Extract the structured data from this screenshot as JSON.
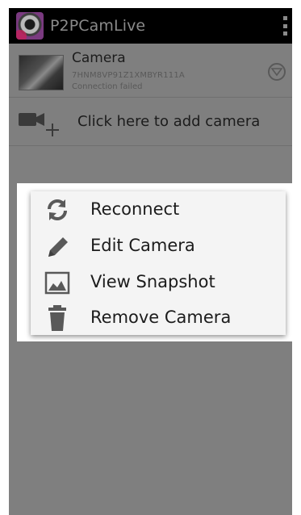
{
  "app": {
    "title": "P2PCamLive"
  },
  "camera": {
    "name": "Camera",
    "id": "7HNM8VP91Z1XMBYR111A",
    "status": "Connection failed"
  },
  "add_camera": {
    "label": "Click here to add camera"
  },
  "context_menu": {
    "items": [
      {
        "label": "Reconnect",
        "icon": "refresh-icon"
      },
      {
        "label": "Edit Camera",
        "icon": "pencil-icon"
      },
      {
        "label": "View Snapshot",
        "icon": "image-icon"
      },
      {
        "label": "Remove Camera",
        "icon": "trash-icon"
      }
    ]
  },
  "colors": {
    "action_bar": "#000000",
    "background": "#7f7f7f",
    "dialog": "#f4f4f4",
    "icon": "#595959"
  }
}
